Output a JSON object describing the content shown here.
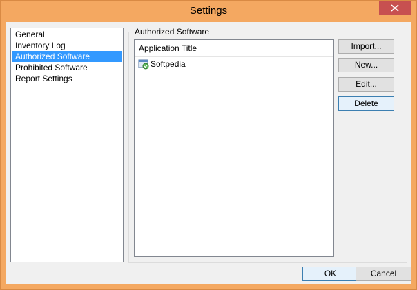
{
  "window": {
    "title": "Settings",
    "close_glyph": "✕"
  },
  "nav": {
    "items": [
      {
        "label": "General",
        "selected": false
      },
      {
        "label": "Inventory Log",
        "selected": false
      },
      {
        "label": "Authorized Software",
        "selected": true
      },
      {
        "label": "Prohibited Software",
        "selected": false
      },
      {
        "label": "Report Settings",
        "selected": false
      }
    ]
  },
  "panel": {
    "group_label": "Authorized Software",
    "list": {
      "column_header": "Application Title",
      "rows": [
        {
          "title": "Softpedia",
          "icon": "application-icon"
        }
      ]
    },
    "buttons": {
      "import": "Import...",
      "new": "New...",
      "edit": "Edit...",
      "delete": "Delete"
    }
  },
  "footer": {
    "ok": "OK",
    "cancel": "Cancel"
  },
  "colors": {
    "title_bar": "#f4a861",
    "close_button": "#c75050",
    "selection": "#3399ff"
  }
}
